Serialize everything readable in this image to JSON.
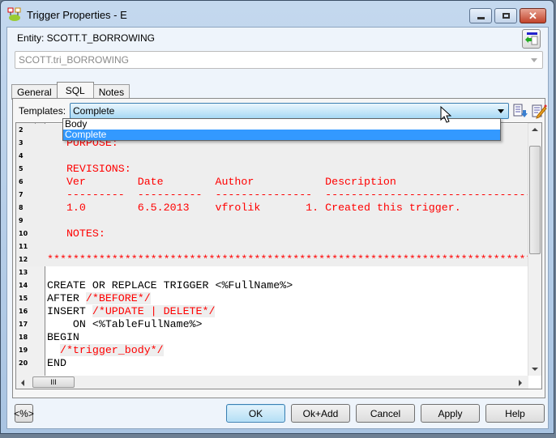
{
  "window": {
    "title": "Trigger Properties - E"
  },
  "entity_label": "Entity: SCOTT.T_BORROWING",
  "name_field": {
    "value": "SCOTT.tri_BORROWING"
  },
  "tabs": [
    {
      "label": "General"
    },
    {
      "label": "SQL"
    },
    {
      "label": "Notes"
    }
  ],
  "templates": {
    "label": "Templates:",
    "selected": "Complete",
    "options": [
      "Body",
      "Complete"
    ]
  },
  "editor": {
    "lines": [
      {
        "n": "2",
        "text": "",
        "type": "cmt"
      },
      {
        "n": "3",
        "text": "   PURPOSE:",
        "type": "cmt"
      },
      {
        "n": "4",
        "text": "",
        "type": "cmt"
      },
      {
        "n": "5",
        "text": "   REVISIONS:",
        "type": "cmt"
      },
      {
        "n": "6",
        "text": "   Ver        Date        Author           Description",
        "type": "cmt"
      },
      {
        "n": "7",
        "text": "   ---------  ----------  ---------------  ------------------------------------",
        "type": "cmt"
      },
      {
        "n": "8",
        "text": "   1.0        6.5.2013    vfrolik       1. Created this trigger.",
        "type": "cmt"
      },
      {
        "n": "9",
        "text": "",
        "type": "cmt"
      },
      {
        "n": "10",
        "text": "   NOTES:",
        "type": "cmt"
      },
      {
        "n": "11",
        "text": "",
        "type": "cmt"
      },
      {
        "n": "12",
        "text": "********************************************************************************",
        "type": "cmt"
      },
      {
        "n": "13",
        "text": "",
        "type": "code"
      },
      {
        "n": "14",
        "text": "CREATE OR REPLACE TRIGGER <%FullName%>",
        "type": "code"
      },
      {
        "n": "15",
        "kw": "AFTER ",
        "c": "/*BEFORE*/",
        "type": "mix"
      },
      {
        "n": "16",
        "kw": "INSERT ",
        "c": "/*UPDATE | DELETE*/",
        "type": "mix"
      },
      {
        "n": "17",
        "text": "    ON <%TableFullName%>",
        "type": "code"
      },
      {
        "n": "18",
        "text": "BEGIN",
        "type": "code"
      },
      {
        "n": "19",
        "kw": "  ",
        "c": "/*trigger_body*/",
        "type": "mix"
      },
      {
        "n": "20",
        "text": "END",
        "type": "code"
      }
    ]
  },
  "scroll_grip": "III",
  "buttons": {
    "macro": "<%>",
    "ok": "OK",
    "ok_add": "Ok+Add",
    "cancel": "Cancel",
    "apply": "Apply",
    "help": "Help"
  }
}
